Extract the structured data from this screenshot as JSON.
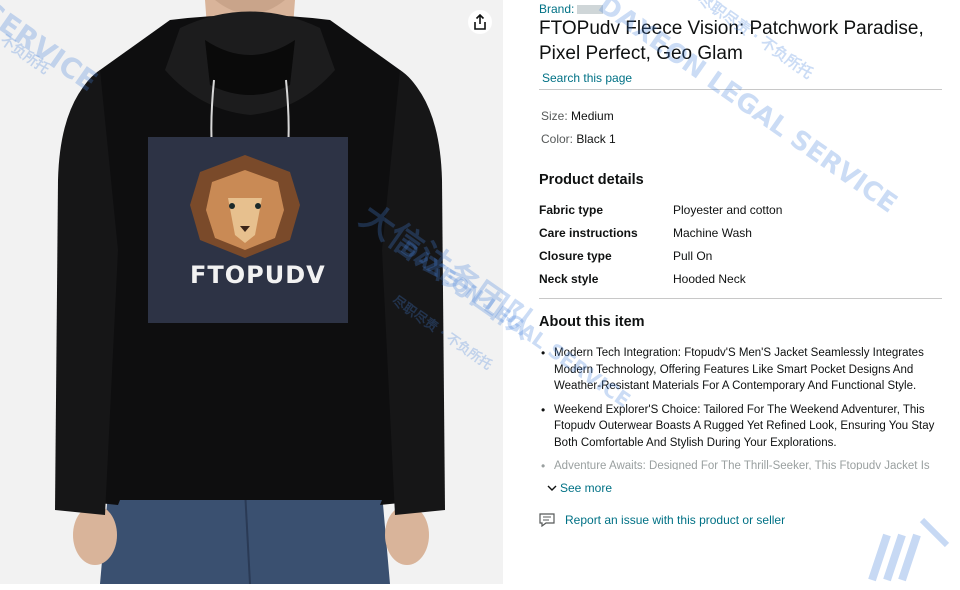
{
  "gallery": {
    "logo_text": "FTOPUDV"
  },
  "product": {
    "brand_label": "Brand:",
    "title": "FTOPudv Fleece Vision: Patchwork Paradise, Pixel Perfect, Geo Glam",
    "search_link": "Search this page"
  },
  "attributes": [
    {
      "key": "Size:",
      "value": "Medium"
    },
    {
      "key": "Color:",
      "value": "Black 1"
    }
  ],
  "product_details": {
    "heading": "Product details",
    "rows": [
      {
        "key": "Fabric type",
        "value": "Ployester and cotton"
      },
      {
        "key": "Care instructions",
        "value": "Machine Wash"
      },
      {
        "key": "Closure type",
        "value": "Pull On"
      },
      {
        "key": "Neck style",
        "value": "Hooded Neck"
      }
    ]
  },
  "about": {
    "heading": "About this item",
    "bullets": [
      "Modern Tech Integration: Ftopudv'S Men'S Jacket Seamlessly Integrates Modern Technology, Offering Features Like Smart Pocket Designs And Weather-Resistant Materials For A Contemporary And Functional Style.",
      "Weekend Explorer'S Choice: Tailored For The Weekend Adventurer, This Ftopudv Outerwear Boasts A Rugged Yet Refined Look, Ensuring You Stay Both Comfortable And Stylish During Your Explorations.",
      "Adventure Awaits: Designed For The Thrill-Seeker, This Ftopudv Jacket Is"
    ],
    "see_more": "See more"
  },
  "report": {
    "label": "Report an issue with this product or seller"
  },
  "watermark": {
    "en": "DAXEON LEGAL SERVICE",
    "en_short": "SERVICE",
    "cn_team": "大信法务团队",
    "cn_slogan": "尽职尽责 · 不负所托",
    "cn_slogan_short": "不负所托"
  }
}
